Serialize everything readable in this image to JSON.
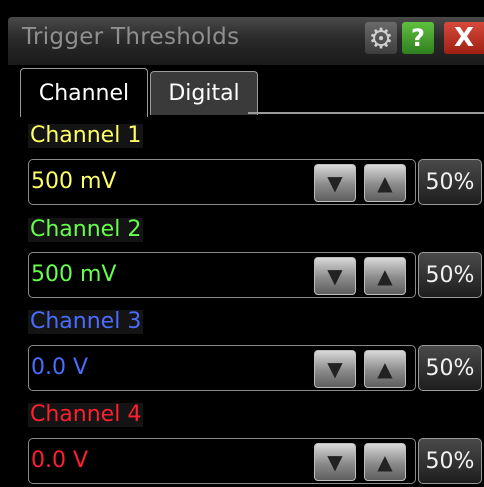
{
  "window": {
    "title": "Trigger Thresholds",
    "buttons": {
      "settings": "gear-icon",
      "help": "?",
      "close": "X"
    }
  },
  "tabs": [
    {
      "label": "Channel",
      "active": true
    },
    {
      "label": "Digital",
      "active": false
    }
  ],
  "channels": [
    {
      "label": "Channel 1",
      "value": "500 mV",
      "color": "#ffff66",
      "percent_label": "50%"
    },
    {
      "label": "Channel 2",
      "value": "500 mV",
      "color": "#66ff4d",
      "percent_label": "50%"
    },
    {
      "label": "Channel 3",
      "value": "0.0 V",
      "color": "#4a6cff",
      "percent_label": "50%"
    },
    {
      "label": "Channel 4",
      "value": "0.0 V",
      "color": "#ff1f2f",
      "percent_label": "50%"
    }
  ],
  "icons": {
    "down": "chevron-down-icon",
    "up": "chevron-up-icon"
  }
}
